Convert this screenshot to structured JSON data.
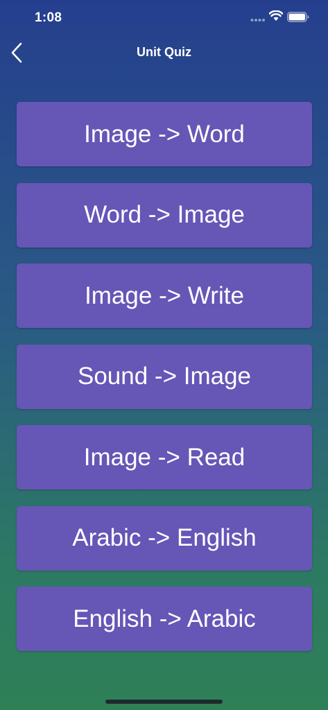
{
  "status_bar": {
    "time": "1:08",
    "icons": [
      "signal-icon",
      "wifi-icon",
      "battery-icon"
    ]
  },
  "nav": {
    "title": "Unit Quiz",
    "back_icon": "chevron-left-icon"
  },
  "quiz_options": [
    {
      "label": "Image -> Word"
    },
    {
      "label": "Word -> Image"
    },
    {
      "label": "Image -> Write"
    },
    {
      "label": "Sound -> Image"
    },
    {
      "label": "Image -> Read"
    },
    {
      "label": "Arabic -> English"
    },
    {
      "label": "English -> Arabic"
    }
  ],
  "colors": {
    "background_top": "#253f8e",
    "background_bottom": "#2e8057",
    "button": "#6656b6",
    "text": "#ffffff"
  }
}
